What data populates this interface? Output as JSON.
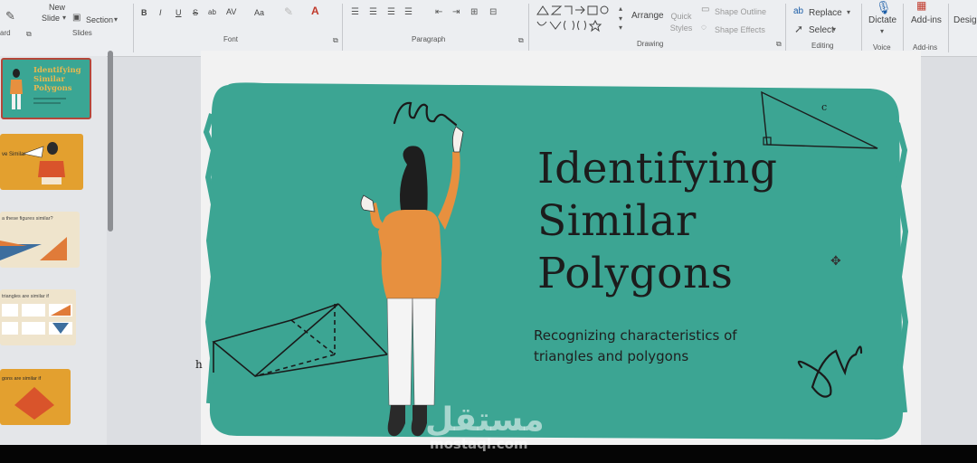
{
  "ribbon": {
    "new_slide_label": "New",
    "slide_label": "Slide",
    "section_label": "Section",
    "groups": {
      "board": "ard",
      "slides": "Slides",
      "font": "Font",
      "paragraph": "Paragraph",
      "drawing": "Drawing",
      "editing": "Editing",
      "voice": "Voice",
      "addins": "Add-ins"
    },
    "font_buttons": [
      "B",
      "I",
      "U",
      "S",
      "ab",
      "AV",
      "Aa"
    ],
    "arrange_label": "Arrange",
    "quick_styles_label": "Quick Styles",
    "shape_outline_label": "Shape Outline",
    "shape_effects_label": "Shape Effects",
    "replace_label": "Replace",
    "select_label": "Select",
    "dictate_label": "Dictate",
    "addins_label": "Add-ins",
    "design_label": "Desig"
  },
  "thumbnails": [
    {
      "title_lines": [
        "Identifying",
        "Similar",
        "Polygons"
      ],
      "bg": "#3aa694",
      "selected": true
    },
    {
      "title_lines": [
        "ve Similar"
      ],
      "bg": "#e3a02f",
      "selected": false
    },
    {
      "title_lines": [
        "a these figures similar?"
      ],
      "bg": "#efe4cc",
      "selected": false
    },
    {
      "title_lines": [
        "triangles are similar if"
      ],
      "bg": "#efe4cc",
      "selected": false
    },
    {
      "title_lines": [
        "gons are similar if"
      ],
      "bg": "#e3a02f",
      "selected": false
    }
  ],
  "slide": {
    "title_lines": [
      "Identifying",
      "Similar",
      "Polygons"
    ],
    "subtitle_lines": [
      "Recognizing characteristics of",
      "triangles and polygons"
    ],
    "triangle_label": "c",
    "prism_label": "h"
  },
  "watermark": {
    "arabic": "مستقل",
    "latin": "mostaql.com"
  },
  "colors": {
    "slide_teal": "#3ca593",
    "orange": "#e7903f",
    "ribbon_bg": "#eceef1",
    "accent_blue": "#1d5fa8"
  }
}
